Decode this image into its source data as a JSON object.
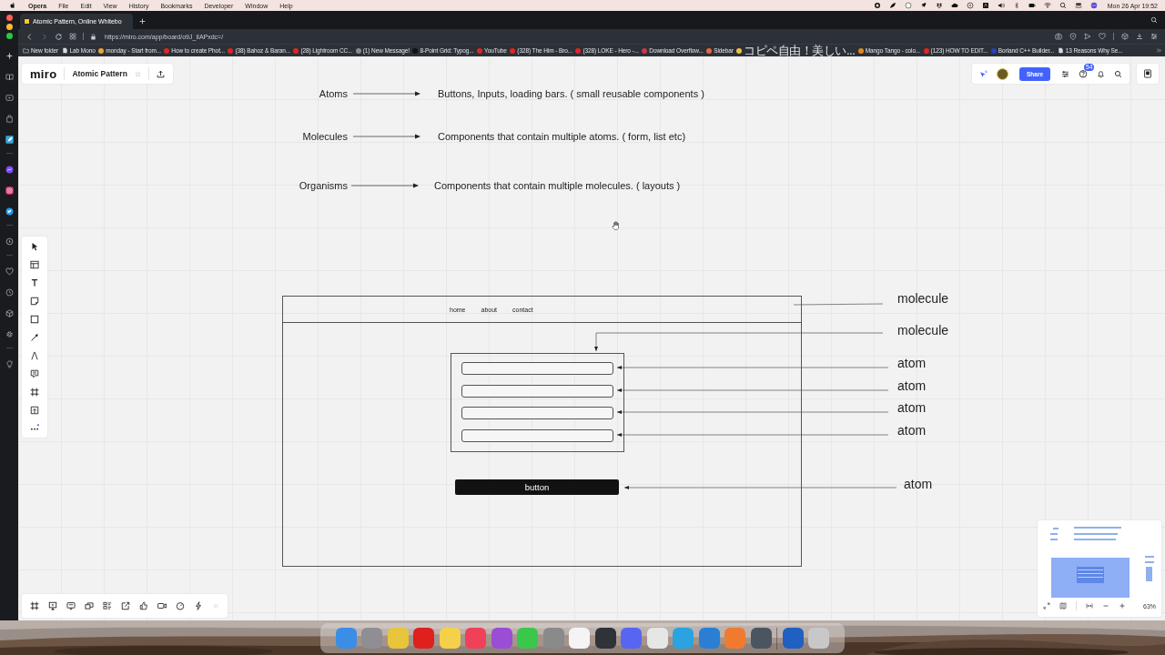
{
  "menu_bar": {
    "app": "Opera",
    "menus": [
      "File",
      "Edit",
      "View",
      "History",
      "Bookmarks",
      "Developer",
      "Window",
      "Help"
    ],
    "clock": "Mon 26 Apr  19:52"
  },
  "tabs": [
    {
      "title": "Atomic Pattern, Online Whitebo",
      "selected": true
    }
  ],
  "address_bar": {
    "url": "https://miro.com/app/board/o9J_lIAPxdc=/"
  },
  "bookmarks": [
    {
      "label": "New folder",
      "kind": "folder"
    },
    {
      "label": "Lab Mono",
      "kind": "page"
    },
    {
      "label": "monday - Start from...",
      "kind": "site",
      "color": "#e8a33d"
    },
    {
      "label": "How to create Phot...",
      "kind": "site",
      "color": "#e02424"
    },
    {
      "label": "(38) Bahoz & Baran...",
      "kind": "site",
      "color": "#e02424"
    },
    {
      "label": "(28) Lightroom CC...",
      "kind": "site",
      "color": "#e02424"
    },
    {
      "label": "(1) New Message!",
      "kind": "site",
      "color": "#8a8a8a"
    },
    {
      "label": "8-Point Grid: Typog...",
      "kind": "site",
      "color": "#111111"
    },
    {
      "label": "YouTube",
      "kind": "site",
      "color": "#e02424"
    },
    {
      "label": "(328) The Him - Bro...",
      "kind": "site",
      "color": "#e02424"
    },
    {
      "label": "(328) LOKE - Hero -...",
      "kind": "site",
      "color": "#e02424"
    },
    {
      "label": "Download Overflow...",
      "kind": "site",
      "color": "#c23b4a"
    },
    {
      "label": "Sidebar",
      "kind": "site",
      "color": "#e8663d"
    },
    {
      "label": "コピペ自由！美しい...",
      "kind": "site",
      "color": "#f0c040"
    },
    {
      "label": "Mango Tango - colo...",
      "kind": "site",
      "color": "#e08a1e"
    },
    {
      "label": "(123) HOW TO EDIT...",
      "kind": "site",
      "color": "#e02424"
    },
    {
      "label": "Borland C++ Builder...",
      "kind": "site",
      "color": "#2b3fbf"
    },
    {
      "label": "13 Reasons Why Se...",
      "kind": "page"
    }
  ],
  "board": {
    "logo": "miro",
    "title": "Atomic Pattern",
    "share": "Share",
    "help_badge": "54",
    "zoom": "63%"
  },
  "definitions": [
    {
      "term": "Atoms",
      "description": "Buttons, Inputs, loading bars. ( small reusable components )"
    },
    {
      "term": "Molecules",
      "description": "Components that contain multiple atoms. ( form, list etc)"
    },
    {
      "term": "Organisms",
      "description": "Components that contain multiple molecules. ( layouts )"
    }
  ],
  "wireframe": {
    "nav": {
      "links": [
        "home",
        "about",
        "contact"
      ],
      "annotation": "molecule"
    },
    "form": {
      "annotation": "molecule",
      "fields": [
        {
          "annotation": "atom"
        },
        {
          "annotation": "atom"
        },
        {
          "annotation": "atom"
        },
        {
          "annotation": "atom"
        }
      ]
    },
    "button": {
      "label": "button",
      "annotation": "atom"
    }
  },
  "dock": [
    {
      "color": "#3a8ee6"
    },
    {
      "color": "#8e8e93"
    },
    {
      "color": "#e8c53a"
    },
    {
      "color": "#e0201e"
    },
    {
      "color": "#f5d04a"
    },
    {
      "color": "#f0405a"
    },
    {
      "color": "#9b4dd6"
    },
    {
      "color": "#3ac84a"
    },
    {
      "color": "#8a8a8a"
    },
    {
      "color": "#f4f4f4"
    },
    {
      "color": "#2f3338"
    },
    {
      "color": "#5865f2"
    },
    {
      "color": "#e6e6e6"
    },
    {
      "color": "#2aa3e0"
    },
    {
      "color": "#2a7fd4"
    },
    {
      "color": "#f07a30"
    },
    {
      "color": "#4a5560"
    },
    {
      "color": "#2060c0"
    },
    {
      "color": "#c8c8c8"
    }
  ]
}
